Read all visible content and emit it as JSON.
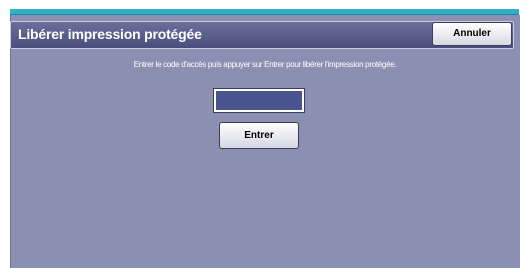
{
  "title_bar": {
    "title": "Libérer impression protégée",
    "cancel_label": "Annuler"
  },
  "main": {
    "instruction": "Entrer le code d'accès puis appuyer sur Entrer pour libérer l'impression protégée.",
    "access_code_value": "",
    "enter_label": "Entrer"
  },
  "colors": {
    "panel_background": "#8b8fb2",
    "title_bar": "#4a4e7c",
    "top_strip": "#2fb0c4",
    "input_background": "#4a5590"
  }
}
